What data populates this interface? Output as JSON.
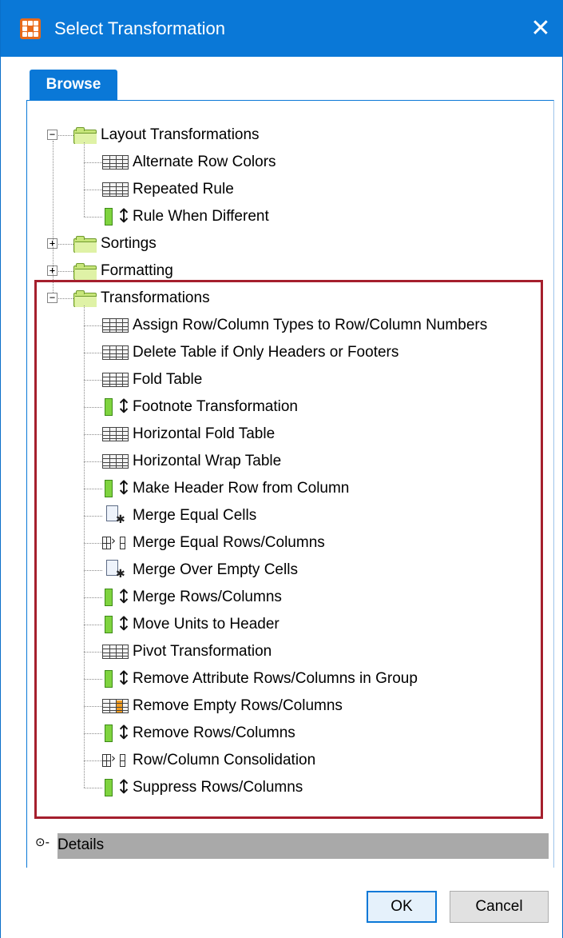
{
  "window": {
    "title": "Select Transformation",
    "close_label": "✕",
    "accent_color": "#0a78d7",
    "highlight_color": "#a51f2d"
  },
  "tabs": [
    {
      "label": "Browse",
      "active": true
    }
  ],
  "tree": {
    "groups": [
      {
        "label": "Layout Transformations",
        "expanded": true,
        "items": [
          {
            "label": "Alternate Row Colors",
            "icon": "table-icon"
          },
          {
            "label": "Repeated Rule",
            "icon": "table-icon"
          },
          {
            "label": "Rule When Different",
            "icon": "rule-icon"
          }
        ]
      },
      {
        "label": "Sortings",
        "expanded": false,
        "items": []
      },
      {
        "label": "Formatting",
        "expanded": false,
        "items": []
      },
      {
        "label": "Transformations",
        "expanded": true,
        "items": [
          {
            "label": "Assign Row/Column Types to Row/Column Numbers",
            "icon": "table-icon"
          },
          {
            "label": "Delete Table if Only Headers or Footers",
            "icon": "table-icon"
          },
          {
            "label": "Fold Table",
            "icon": "table-icon"
          },
          {
            "label": "Footnote Transformation",
            "icon": "rule-icon"
          },
          {
            "label": "Horizontal Fold Table",
            "icon": "table-icon"
          },
          {
            "label": "Horizontal Wrap Table",
            "icon": "table-icon"
          },
          {
            "label": "Make Header Row from Column",
            "icon": "rule-icon"
          },
          {
            "label": "Merge Equal Cells",
            "icon": "doc-icon"
          },
          {
            "label": "Merge Equal Rows/Columns",
            "icon": "merge-icon"
          },
          {
            "label": "Merge Over Empty Cells",
            "icon": "doc-icon"
          },
          {
            "label": "Merge Rows/Columns",
            "icon": "rule-icon"
          },
          {
            "label": "Move Units to Header",
            "icon": "rule-icon"
          },
          {
            "label": "Pivot Transformation",
            "icon": "table-icon"
          },
          {
            "label": "Remove Attribute Rows/Columns in Group",
            "icon": "rule-icon"
          },
          {
            "label": "Remove Empty Rows/Columns",
            "icon": "table-orange-icon"
          },
          {
            "label": "Remove Rows/Columns",
            "icon": "rule-icon"
          },
          {
            "label": "Row/Column Consolidation",
            "icon": "merge-icon"
          },
          {
            "label": "Suppress Rows/Columns",
            "icon": "rule-icon"
          }
        ]
      }
    ]
  },
  "details": {
    "label": "Details"
  },
  "buttons": {
    "ok": "OK",
    "cancel": "Cancel"
  }
}
